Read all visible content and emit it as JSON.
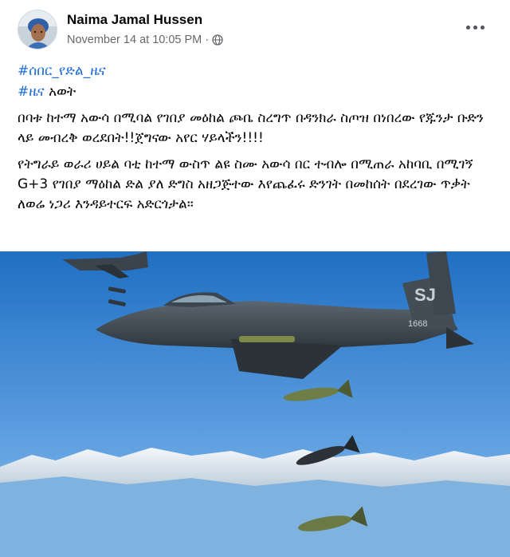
{
  "post": {
    "author": "Naima Jamal Hussen",
    "timestamp": "November 14 at 10:05 PM",
    "separator": "·",
    "hashtags": {
      "line1": "#ሰበር_የድል_ዜና",
      "line2_tag": "#ዜና",
      "line2_text": " አወት"
    },
    "paragraph1": "በባቱ ከተማ አውሳ በሚባል የገበያ መዕከል ጮቤ ስረግጥ በዳንክራ ስጦዝ በነበረው የጁንታ ቡድን ላይ መብረቅ ወረደበት!!ጀግናው አየር ሃይላችን!!!!",
    "paragraph2": "የትግራይ ወራሪ ሀይል ባቲ ከተማ ውስጥ ልዩ ስሙ አውሳ በር ተብሎ በሚጠራ አከባቢ በሚገኝ G+3 የገበያ ማዕከል ድል ያለ ድግስ አዘጋጅተው እየጨፈሩ ድንገት በመከሰት በደረገው ጥቃት ለወሬ ነጋሪ እንዳይተርፍ አድርጎታል።",
    "photo": {
      "aircraft_tail": "SJ",
      "aircraft_serial": "1668"
    }
  },
  "colors": {
    "hashtag": "#216fdb",
    "meta": "#65676b",
    "sky_top": "#1f6fc3",
    "sky_bottom": "#8ec0ea"
  },
  "icons": {
    "privacy": "globe-icon",
    "options": "more-options-icon"
  }
}
